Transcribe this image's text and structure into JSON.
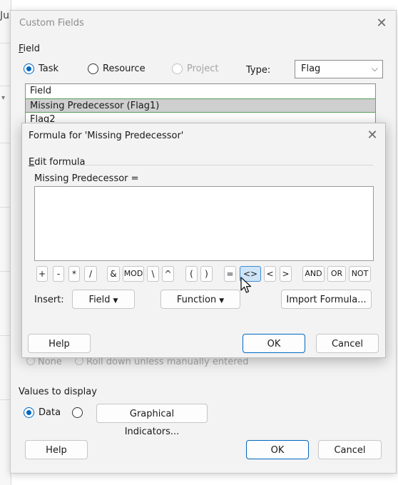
{
  "background": {
    "tab_text": "Ju"
  },
  "custom_fields": {
    "title": "Custom Fields",
    "field_label": "Field",
    "radios": {
      "task": "Task",
      "resource": "Resource",
      "project": "Project"
    },
    "type_label": "Type:",
    "type_value": "Flag",
    "list": {
      "header": "Field",
      "items": [
        "Missing Predecessor (Flag1)",
        "Flag2"
      ]
    },
    "rollup_options": {
      "none": "None",
      "rolldown": "Roll down unless manually entered"
    },
    "values_to_display": "Values to display",
    "values_radio": {
      "data": "Data"
    },
    "graphical_indicators": "Graphical Indicators...",
    "help": "Help",
    "ok": "OK",
    "cancel": "Cancel"
  },
  "formula": {
    "title": "Formula for 'Missing Predecessor'",
    "edit_formula": "Edit formula",
    "formula_prefix": "Missing Predecessor =",
    "operators": [
      "+",
      "-",
      "*",
      "/",
      "&",
      "MOD",
      "\\",
      "^",
      "(",
      ")",
      "=",
      "<>",
      "<",
      ">",
      "AND",
      "OR",
      "NOT"
    ],
    "insert_label": "Insert:",
    "field_btn": "Field",
    "function_btn": "Function",
    "import_btn": "Import Formula...",
    "help": "Help",
    "ok": "OK",
    "cancel": "Cancel"
  },
  "colors": {
    "accent": "#0067c0",
    "selected_row": "#cfcfcf",
    "active_op": "#cfe4f7"
  }
}
